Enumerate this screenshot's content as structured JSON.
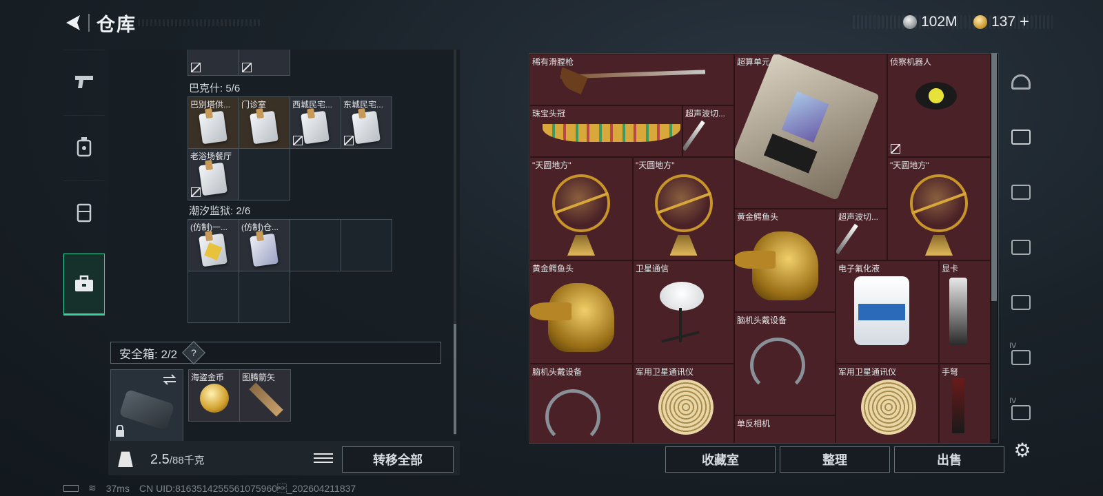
{
  "header": {
    "title": "仓库"
  },
  "currency": {
    "silver": "102M",
    "gold": "137",
    "plus": "+"
  },
  "left": {
    "sections": [
      {
        "label": "巴克什: 5/6",
        "items": [
          "巴别塔供...",
          "门诊室",
          "西城民宅...",
          "东城民宅...",
          "老浴场餐厅"
        ]
      },
      {
        "label": "潮汐监狱: 2/6",
        "items": [
          "(仿制)一...",
          "(仿制)仓..."
        ]
      }
    ],
    "safebox": {
      "label": "安全箱: 2/2",
      "help": "?",
      "items": [
        "海盗金币",
        "图腾箭矢"
      ]
    },
    "weight": {
      "current": "2.5",
      "max": "/88千克"
    },
    "transfer_label": "转移全部"
  },
  "stash": {
    "items": [
      {
        "name": "稀有滑膛枪"
      },
      {
        "name": "超算单元"
      },
      {
        "name": "侦察机器人"
      },
      {
        "name": "珠宝头冠"
      },
      {
        "name": "超声波切..."
      },
      {
        "name": "\"天圆地方\""
      },
      {
        "name": "\"天圆地方\""
      },
      {
        "name": "\"天圆地方\""
      },
      {
        "name": "黄金鳄鱼头"
      },
      {
        "name": "超声波切..."
      },
      {
        "name": "黄金鳄鱼头"
      },
      {
        "name": "卫星通信"
      },
      {
        "name": "电子氟化液"
      },
      {
        "name": "显卡"
      },
      {
        "name": "脑机头戴设备"
      },
      {
        "name": "脑机头戴设备"
      },
      {
        "name": "军用卫星通讯仪"
      },
      {
        "name": "军用卫星通讯仪"
      },
      {
        "name": "手弩"
      },
      {
        "name": "单反相机"
      }
    ],
    "buttons": {
      "collection": "收藏室",
      "sort": "整理",
      "sell": "出售"
    },
    "side_tabs": {
      "tab_4": "IV",
      "tab_5": "IV"
    }
  },
  "status": {
    "ping": "37ms",
    "uid": "CN UID:8163514255561075960\u0006_202604211837"
  }
}
